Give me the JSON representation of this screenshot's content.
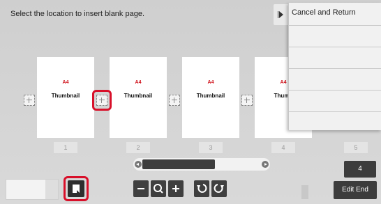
{
  "header": {
    "instruction": "Select the location to insert blank page."
  },
  "side_panel": {
    "title": "Cancel and Return"
  },
  "thumbnails": [
    {
      "size": "A4",
      "label": "Thumbnail",
      "page": "1"
    },
    {
      "size": "A4",
      "label": "Thumbnail",
      "page": "2"
    },
    {
      "size": "A4",
      "label": "Thumbnail",
      "page": "3"
    },
    {
      "size": "A4",
      "label": "Thumb",
      "page": "4"
    },
    {
      "page": "5"
    }
  ],
  "page_count": "4",
  "footer": {
    "edit_end": "Edit End"
  },
  "colors": {
    "highlight": "#d8102a",
    "size_text": "#d0121b"
  },
  "icons": [
    "zoom-out-icon",
    "magnify-icon",
    "zoom-in-icon",
    "rotate-left-icon",
    "rotate-right-icon",
    "blank-page-icon",
    "panel-collapse-icon"
  ]
}
